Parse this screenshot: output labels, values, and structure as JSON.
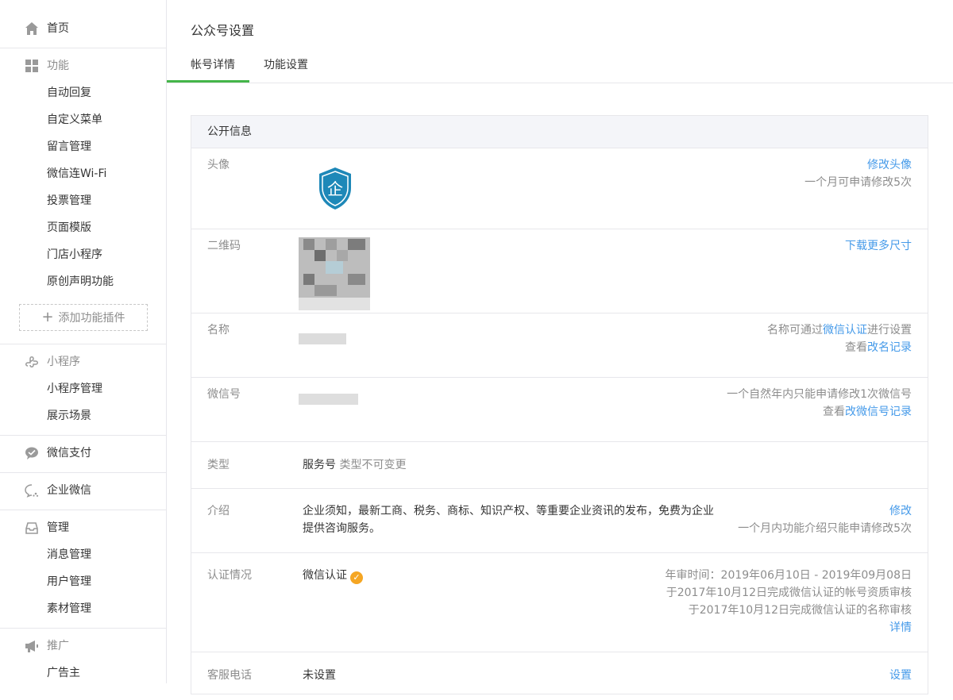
{
  "sidebar": {
    "home": "首页",
    "features": {
      "label": "功能",
      "items": [
        "自动回复",
        "自定义菜单",
        "留言管理",
        "微信连Wi-Fi",
        "投票管理",
        "页面模版",
        "门店小程序",
        "原创声明功能"
      ],
      "add_plugin": "添加功能插件"
    },
    "miniprogram": {
      "label": "小程序",
      "items": [
        "小程序管理",
        "展示场景"
      ]
    },
    "wechat_pay": "微信支付",
    "wecom": "企业微信",
    "manage": {
      "label": "管理",
      "items": [
        "消息管理",
        "用户管理",
        "素材管理"
      ]
    },
    "promote": {
      "label": "推广",
      "items": [
        "广告主"
      ]
    }
  },
  "main": {
    "title": "公众号设置",
    "tabs": [
      "帐号详情",
      "功能设置"
    ],
    "section_title": "公开信息",
    "avatar": {
      "label": "头像",
      "glyph": "企",
      "action": "修改头像",
      "note": "一个月可申请修改5次"
    },
    "qrcode": {
      "label": "二维码",
      "action": "下载更多尺寸"
    },
    "name": {
      "label": "名称",
      "note_prefix": "名称可通过",
      "note_link": "微信认证",
      "note_suffix": "进行设置",
      "history_prefix": "查看",
      "history_link": "改名记录"
    },
    "wechat_id": {
      "label": "微信号",
      "note": "一个自然年内只能申请修改1次微信号",
      "history_prefix": "查看",
      "history_link": "改微信号记录"
    },
    "type": {
      "label": "类型",
      "value": "服务号",
      "note": "类型不可变更"
    },
    "intro": {
      "label": "介绍",
      "value_line1": "企业须知，最新工商、税务、商标、知识产权、等重要企业资讯的发布，免费为企业",
      "value_line2": "提供咨询服务。",
      "action": "修改",
      "note": "一个月内功能介绍只能申请修改5次"
    },
    "verify": {
      "label": "认证情况",
      "value": "微信认证",
      "line1": "年审时间：2019年06月10日 - 2019年09月08日",
      "line2": "于2017年10月12日完成微信认证的帐号资质审核",
      "line3": "于2017年10月12日完成微信认证的名称审核",
      "action": "详情"
    },
    "service_phone": {
      "label": "客服电话",
      "value": "未设置",
      "action": "设置"
    }
  },
  "colors": {
    "accent_green": "#44b549",
    "link_blue": "#459ae9",
    "badge_orange": "#f5a623",
    "shield_blue": "#1e88b8"
  }
}
